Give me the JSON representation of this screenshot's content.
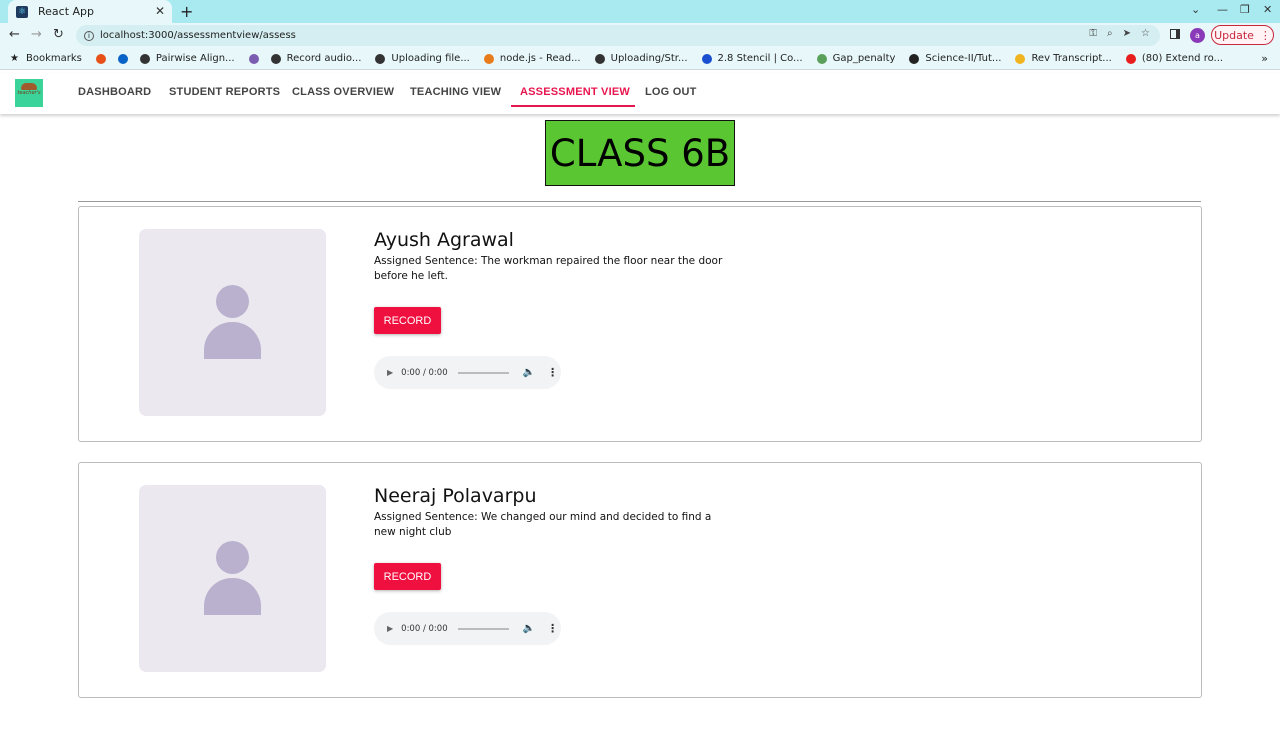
{
  "browser": {
    "tab_title": "React App",
    "url": "localhost:3000/assessmentview/assess",
    "update_label": "Update",
    "profile_initial": "a",
    "bookmarks": [
      {
        "label": "Bookmarks",
        "color": "#333333"
      },
      {
        "label": "",
        "color": "#e8501a"
      },
      {
        "label": "",
        "color": "#0a64c8"
      },
      {
        "label": "Pairwise Align...",
        "color": "#333333"
      },
      {
        "label": "",
        "color": "#7a5cb0"
      },
      {
        "label": "Record audio...",
        "color": "#333333"
      },
      {
        "label": "Uploading file...",
        "color": "#333333"
      },
      {
        "label": "node.js - Read...",
        "color": "#e87b1a"
      },
      {
        "label": "Uploading/Str...",
        "color": "#333333"
      },
      {
        "label": "2.8 Stencil | Co...",
        "color": "#1a4fd0"
      },
      {
        "label": "Gap_penalty",
        "color": "#5aa05a"
      },
      {
        "label": "Science-II/Tut...",
        "color": "#222222"
      },
      {
        "label": "Rev Transcript...",
        "color": "#f0b41e"
      },
      {
        "label": "(80) Extend ro...",
        "color": "#e81e1e"
      }
    ]
  },
  "nav": {
    "logo_text": "teacher's",
    "links": [
      "DASHBOARD",
      "STUDENT REPORTS",
      "CLASS OVERVIEW",
      "TEACHING VIEW",
      "ASSESSMENT VIEW",
      "LOG OUT"
    ],
    "active": "ASSESSMENT VIEW"
  },
  "page": {
    "class_title": "CLASS 6B"
  },
  "students": [
    {
      "name": "Ayush Agrawal",
      "sentence": "Assigned Sentence: The workman repaired the floor near the door before he left.",
      "record_label": "RECORD",
      "audio_time": "0:00 / 0:00"
    },
    {
      "name": "Neeraj Polavarpu",
      "sentence": "Assigned Sentence: We changed our mind and decided to find a new night club",
      "record_label": "RECORD",
      "audio_time": "0:00 / 0:00"
    }
  ],
  "colors": {
    "accent": "#e8164e",
    "record_button": "#f0103f",
    "class_title_bg": "#5ac632"
  }
}
